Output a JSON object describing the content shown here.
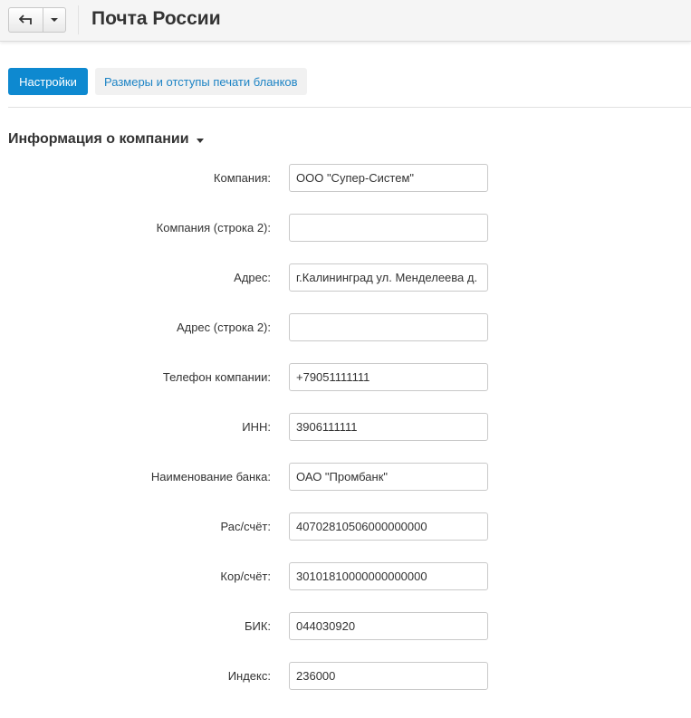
{
  "header": {
    "title": "Почта России",
    "back_icon": "back-arrow-icon",
    "dropdown_icon": "caret-down-icon"
  },
  "tabs": [
    {
      "label": "Настройки",
      "active": true
    },
    {
      "label": "Размеры и отступы печати бланков",
      "active": false
    }
  ],
  "section": {
    "title": "Информация о компании",
    "icon": "caret-down-icon"
  },
  "fields": [
    {
      "label": "Компания:",
      "value": "ООО \"Супер-Систем\""
    },
    {
      "label": "Компания (строка 2):",
      "value": ""
    },
    {
      "label": "Адрес:",
      "value": "г.Калининград ул. Менделеева д."
    },
    {
      "label": "Адрес (строка 2):",
      "value": ""
    },
    {
      "label": "Телефон компании:",
      "value": "+79051111111"
    },
    {
      "label": "ИНН:",
      "value": "3906111111"
    },
    {
      "label": "Наименование банка:",
      "value": "ОАО \"Промбанк\""
    },
    {
      "label": "Рас/счёт:",
      "value": "40702810506000000000"
    },
    {
      "label": "Кор/счёт:",
      "value": "30101810000000000000"
    },
    {
      "label": "БИК:",
      "value": "044030920"
    },
    {
      "label": "Индекс:",
      "value": "236000"
    }
  ],
  "colors": {
    "accent": "#0e89d0",
    "link": "#1d84c5",
    "border": "#c9c9c9"
  }
}
